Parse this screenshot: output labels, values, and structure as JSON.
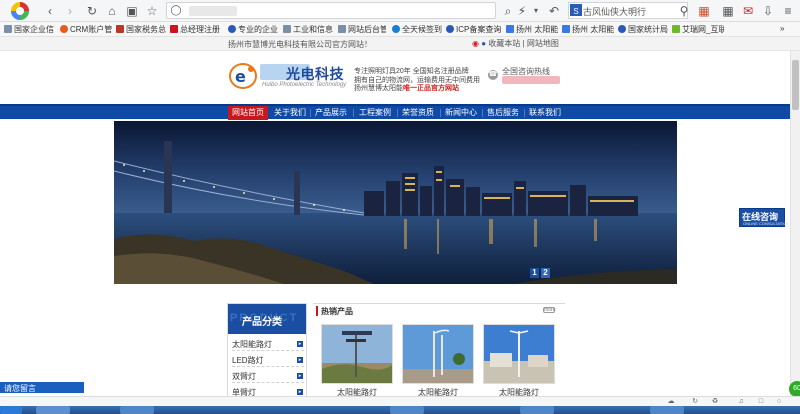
{
  "browser": {
    "search_text": "古风仙侠大明行",
    "address_placeholder": ""
  },
  "bookmarks": [
    {
      "label": "国家企业信",
      "color": "#7a8fa8"
    },
    {
      "label": "CRM账户管",
      "color": "#e85b1b"
    },
    {
      "label": "国家税务总",
      "color": "#b63a2b"
    },
    {
      "label": "总经理注册",
      "color": "#c8171e"
    },
    {
      "label": "专业的企业",
      "color": "#2a5ab8"
    },
    {
      "label": "工业和信息",
      "color": "#7a8fa8"
    },
    {
      "label": "网站后台管",
      "color": "#7a8fa8"
    },
    {
      "label": "全天候签到",
      "color": "#1a7fd0"
    },
    {
      "label": "ICP备案查询",
      "color": "#2a5ab8"
    },
    {
      "label": "扬州 太阳能",
      "color": "#3a7ae0"
    },
    {
      "label": "扬州 太阳能",
      "color": "#3a7ae0"
    },
    {
      "label": "国家统计局",
      "color": "#2a5ab8"
    },
    {
      "label": "艾瑞网_互联",
      "color": "#6fb82e"
    }
  ],
  "site": {
    "welcome": "扬州市慧博光电科技有限公司官方网站！",
    "strip_links": "收藏本站 | 网站地图",
    "brand_name": "光电科技",
    "brand_sub": "Huibo Photoelectric Technology",
    "slogan_line1": "专注照明灯具20年 全国知名注册品牌",
    "slogan_line2": "拥有自己的物流网，运输费用无中间费用",
    "slogan_line3_prefix": "扬州慧博太阳能",
    "slogan_line3_highlight": "唯一正品官方网站",
    "hotline_label": "全国咨询热线"
  },
  "nav": {
    "items": [
      "网站首页",
      "关于我们",
      "产品展示",
      "工程案例",
      "荣誉资质",
      "新闻中心",
      "售后服务",
      "联系我们"
    ],
    "active_index": 0
  },
  "banner": {
    "pages": [
      "1",
      "2"
    ],
    "active_page": 1
  },
  "categories": {
    "title": "产品分类",
    "bg_text": "PRODUCT",
    "items": [
      "太阳能路灯",
      "LED路灯",
      "双臂灯",
      "单臂灯"
    ]
  },
  "hot_products": {
    "title": "热销产品",
    "more": "more",
    "items": [
      "太阳能路灯",
      "太阳能路灯",
      "太阳能路灯"
    ]
  },
  "consult": {
    "title": "在线咨询",
    "sub": "ONLINE CONSULTATION"
  },
  "message_tab": {
    "label": "请您留言"
  },
  "green_badge": "60"
}
